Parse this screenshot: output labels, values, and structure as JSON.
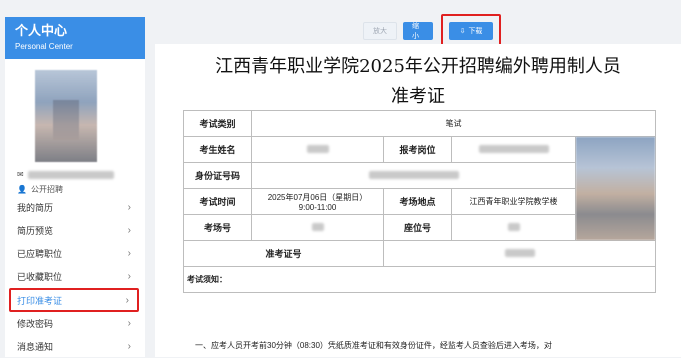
{
  "sidebar": {
    "title": "个人中心",
    "subtitle": "Personal Center",
    "user_role": "公开招聘",
    "menu": [
      {
        "label": "我的简历",
        "active": false
      },
      {
        "label": "简历预览",
        "active": false
      },
      {
        "label": "已应聘职位",
        "active": false
      },
      {
        "label": "已收藏职位",
        "active": false
      },
      {
        "label": "打印准考证",
        "active": true
      },
      {
        "label": "修改密码",
        "active": false
      },
      {
        "label": "消息通知",
        "active": false
      }
    ]
  },
  "toolbar": {
    "zoom_in_label": "放大",
    "zoom_out_label": "缩小",
    "download_label": "下载",
    "accent_color": "#3a8ee6",
    "highlight_color": "#e02020"
  },
  "ticket": {
    "title_line1": "江西青年职业学院2025年公开招聘编外聘用制人员",
    "title_line2": "准考证",
    "exam_type_label": "考试类别",
    "exam_type_value": "笔试",
    "name_label": "考生姓名",
    "position_label": "报考岗位",
    "id_label": "身份证号码",
    "time_label": "考试时间",
    "time_value_line1": "2025年07月06日（星期日）",
    "time_value_line2": "9:00-11:00",
    "place_label": "考场地点",
    "place_value": "江西青年职业学院教学楼",
    "room_label": "考场号",
    "seat_label": "座位号",
    "ticket_no_label": "准考证号",
    "notice_title": "考试须知：",
    "notice_line1": "一、应考人员开考前30分钟（08:30）凭纸质准考证和有效身份证件，经监考人员查验后进入考场，对"
  }
}
